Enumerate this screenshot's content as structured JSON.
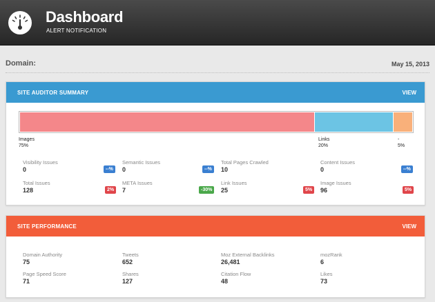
{
  "header": {
    "title": "Dashboard",
    "subtitle": "ALERT NOTIFICATION",
    "logo_icon": "gauge-icon"
  },
  "domain": {
    "label": "Domain:",
    "date": "May 15, 2013"
  },
  "site_auditor": {
    "title": "SITE AUDITOR SUMMARY",
    "view_label": "VIEW",
    "accent_color": "#3a9ad1",
    "breakdown": [
      {
        "name": "Images",
        "percent_label": "75%",
        "fraction": 0.75,
        "color": "#f4878a"
      },
      {
        "name": "Links",
        "percent_label": "20%",
        "fraction": 0.2,
        "color": "#6cc4e4"
      },
      {
        "name": "-",
        "percent_label": "5%",
        "fraction": 0.05,
        "color": "#f9b07a"
      }
    ],
    "metrics": [
      {
        "label": "Visibility Issues",
        "value": "0",
        "badge": "--%",
        "badge_color": "#3a7fd1"
      },
      {
        "label": "Semantic Issues",
        "value": "0",
        "badge": "--%",
        "badge_color": "#3a7fd1"
      },
      {
        "label": "Total Pages Crawled",
        "value": "10",
        "badge": "",
        "badge_color": ""
      },
      {
        "label": "Content Issues",
        "value": "0",
        "badge": "--%",
        "badge_color": "#3a7fd1"
      },
      {
        "label": "Total Issues",
        "value": "128",
        "badge": "2%",
        "badge_color": "#e0454a"
      },
      {
        "label": "META Issues",
        "value": "7",
        "badge": "-30%",
        "badge_color": "#4aa84a"
      },
      {
        "label": "Link Issues",
        "value": "25",
        "badge": "5%",
        "badge_color": "#e0454a"
      },
      {
        "label": "Image Issues",
        "value": "96",
        "badge": "5%",
        "badge_color": "#e0454a"
      }
    ]
  },
  "site_performance": {
    "title": "SITE PERFORMANCE",
    "view_label": "VIEW",
    "accent_color": "#f25d3a",
    "metrics": [
      {
        "label": "Domain Authority",
        "value": "75"
      },
      {
        "label": "Tweets",
        "value": "652"
      },
      {
        "label": "Moz External Backlinks",
        "value": "26,481"
      },
      {
        "label": "mozRank",
        "value": "6"
      },
      {
        "label": "Page Speed Score",
        "value": "71"
      },
      {
        "label": "Shares",
        "value": "127"
      },
      {
        "label": "Citation Flow",
        "value": "48"
      },
      {
        "label": "Likes",
        "value": "73"
      }
    ]
  }
}
